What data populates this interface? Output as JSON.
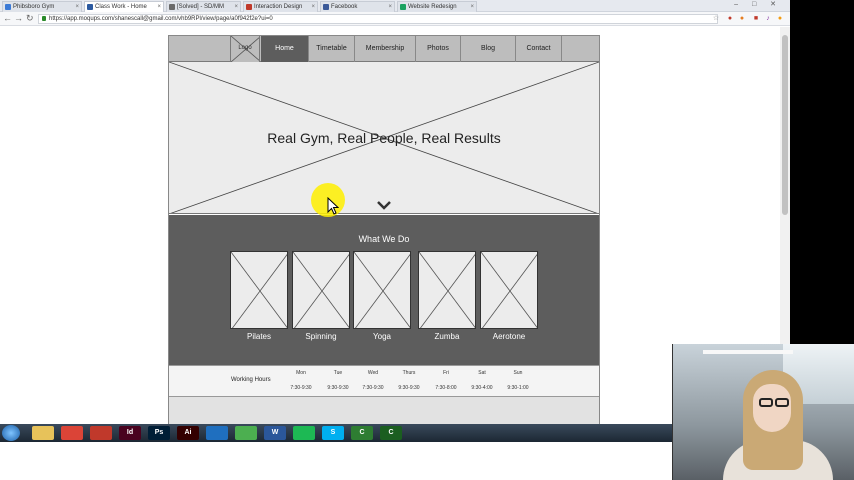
{
  "browser": {
    "tabs": [
      {
        "label": "Phibsboro Gym",
        "color": "#3b7ad6",
        "active": false
      },
      {
        "label": "Class Work - Home",
        "color": "#2c5aa0",
        "active": true
      },
      {
        "label": "[Solved] - SD/MM",
        "color": "#6a6a6a",
        "active": false
      },
      {
        "label": "Interaction Design",
        "color": "#c0392b",
        "active": false
      },
      {
        "label": "Facebook",
        "color": "#3b5998",
        "active": false
      },
      {
        "label": "Website Redesign",
        "color": "#1aa260",
        "active": false
      }
    ],
    "url": "https://app.moqups.com/shanescall@gmail.com/vhb9RPl/view/page/a0f942f2e?ui=0"
  },
  "mockup": {
    "logo_label": "Logo",
    "nav": [
      "Home",
      "Timetable",
      "Membership",
      "Photos",
      "Blog",
      "Contact"
    ],
    "active_nav": "Home",
    "hero_title": "Real Gym, Real People, Real Results",
    "section_title": "What We Do",
    "classes": [
      "Pilates",
      "Spinning",
      "Yoga",
      "Zumba",
      "Aerotone"
    ],
    "hours_title": "Working Hours",
    "days": [
      "Mon",
      "Tue",
      "Wed",
      "Thurs",
      "Fri",
      "Sat",
      "Sun"
    ],
    "times": [
      "7:30-9:30",
      "9:30-9:30",
      "7:30-9:30",
      "9:30-9:30",
      "7:30-8:00",
      "9:30-4:00",
      "9:30-1:00"
    ]
  },
  "taskbar": {
    "apps": [
      {
        "name": "file-explorer-icon",
        "label": "",
        "color": "#e7c25a"
      },
      {
        "name": "chrome-icon",
        "label": "",
        "color": "#db4437"
      },
      {
        "name": "vlc-icon",
        "label": "",
        "color": "#c0392b"
      },
      {
        "name": "indesign-icon",
        "label": "Id",
        "color": "#49021f"
      },
      {
        "name": "photoshop-icon",
        "label": "Ps",
        "color": "#001e36"
      },
      {
        "name": "illustrator-icon",
        "label": "Ai",
        "color": "#330000"
      },
      {
        "name": "camera-app-icon",
        "label": "",
        "color": "#1f6fbf"
      },
      {
        "name": "torrent-icon",
        "label": "",
        "color": "#4caf50"
      },
      {
        "name": "word-icon",
        "label": "W",
        "color": "#2b579a"
      },
      {
        "name": "spotify-icon",
        "label": "",
        "color": "#1db954"
      },
      {
        "name": "skype-icon",
        "label": "S",
        "color": "#00aff0"
      },
      {
        "name": "camtasia-icon",
        "label": "C",
        "color": "#2e7d32"
      },
      {
        "name": "camtasia-recorder-icon",
        "label": "C",
        "color": "#1b5e20"
      }
    ]
  }
}
